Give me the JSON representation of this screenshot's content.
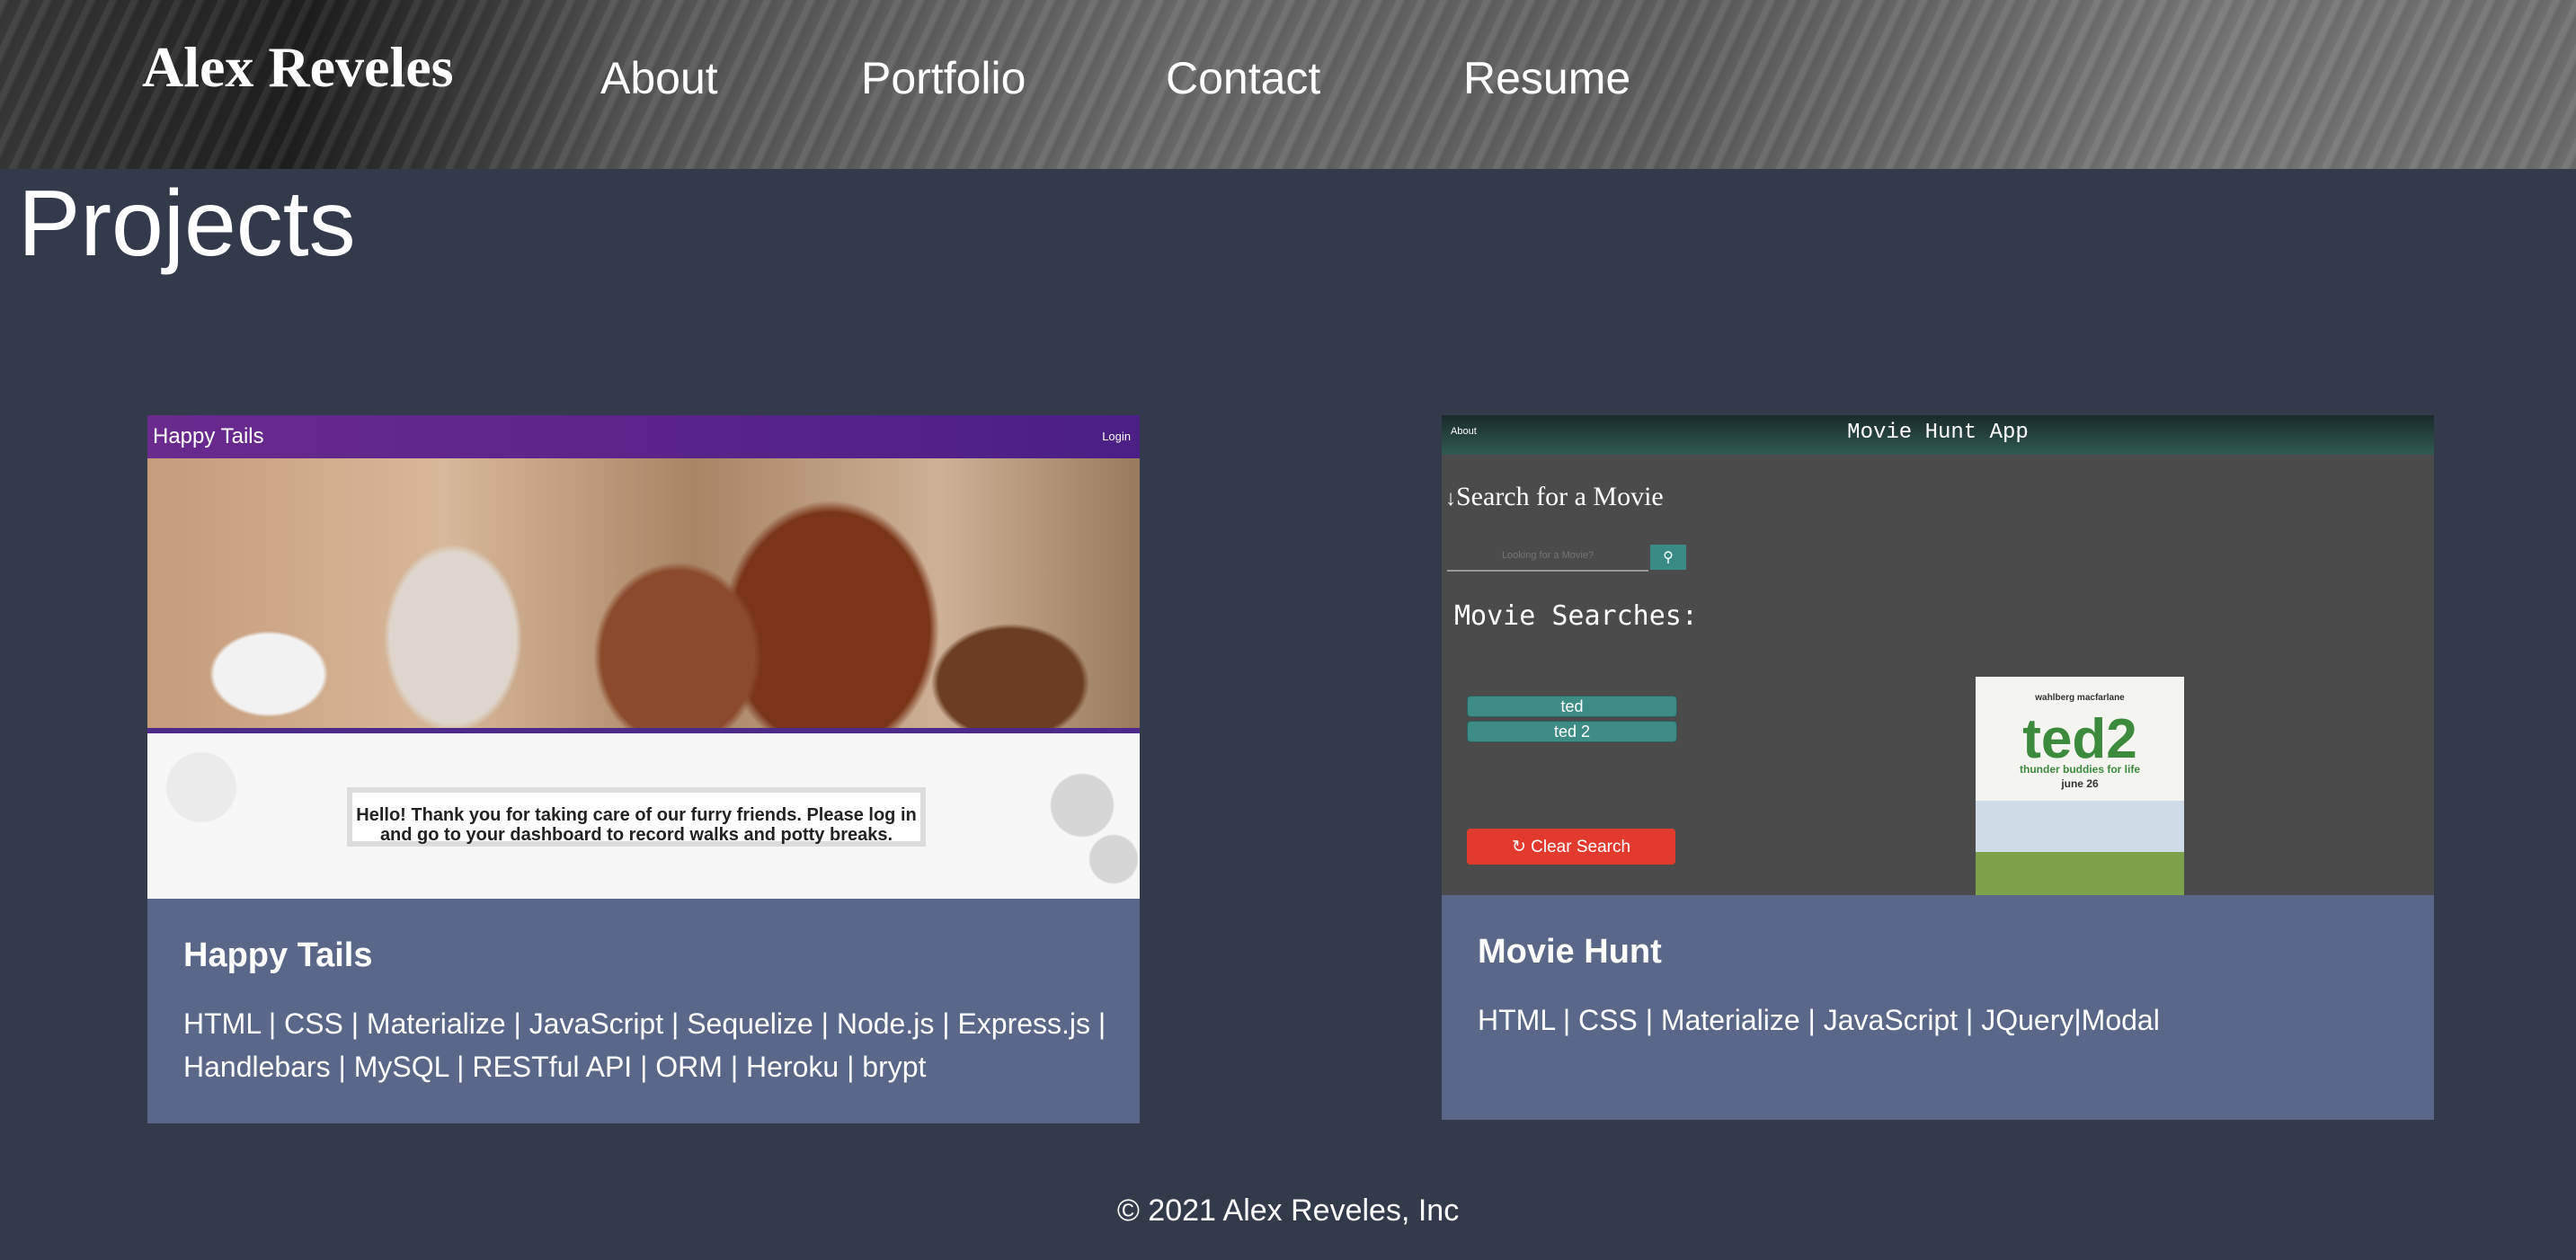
{
  "header": {
    "brand": "Alex Reveles",
    "nav": [
      "About",
      "Portfolio",
      "Contact",
      "Resume"
    ]
  },
  "main": {
    "title": "Projects",
    "projects": [
      {
        "name": "Happy Tails",
        "tech": "HTML | CSS | Materialize | JavaScript | Sequelize | Node.js | Express.js | Handlebars | MySQL | RESTful API | ORM | Heroku | brypt",
        "preview": {
          "brand": "Happy Tails",
          "login": "Login",
          "message": "Hello! Thank you for taking care of our furry friends. Please log in and go to your dashboard to record walks and potty breaks."
        }
      },
      {
        "name": "Movie Hunt",
        "tech": "HTML | CSS | Materialize | JavaScript | JQuery|Modal",
        "preview": {
          "about": "About",
          "title": "Movie Hunt App",
          "search_title": "Search for a Movie",
          "search_placeholder": "Looking for a Movie?",
          "searches_title": "Movie Searches:",
          "searches": [
            "ted",
            "ted 2"
          ],
          "clear": "Clear Search",
          "poster": {
            "actors": "wahlberg     macfarlane",
            "title": "ted2",
            "tagline": "thunder buddies for life",
            "date": "june 26"
          }
        }
      }
    ]
  },
  "footer": {
    "text": "© 2021 Alex Reveles, Inc"
  },
  "colors": {
    "background": "#333a4c",
    "card": "#5a6788",
    "accent_purple": "#6a2a8e",
    "accent_teal": "#3e8c86",
    "clear_red": "#e23a2c"
  }
}
